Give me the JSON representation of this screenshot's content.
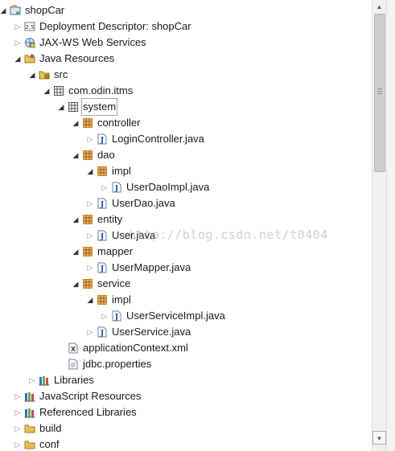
{
  "tree": [
    {
      "label": "shopCar",
      "depth": 0,
      "twisty": "open",
      "icon": "project-icon"
    },
    {
      "label": "Deployment Descriptor: shopCar",
      "depth": 1,
      "twisty": "closed",
      "icon": "descriptor-icon"
    },
    {
      "label": "JAX-WS Web Services",
      "depth": 1,
      "twisty": "closed",
      "icon": "webservice-icon"
    },
    {
      "label": "Java Resources",
      "depth": 1,
      "twisty": "open",
      "icon": "java-resources-icon"
    },
    {
      "label": "src",
      "depth": 2,
      "twisty": "open",
      "icon": "source-folder-icon"
    },
    {
      "label": "com.odin.itms",
      "depth": 3,
      "twisty": "open",
      "icon": "package-empty-icon"
    },
    {
      "label": "system",
      "depth": 4,
      "twisty": "open",
      "icon": "package-empty-icon",
      "selected": true
    },
    {
      "label": "controller",
      "depth": 5,
      "twisty": "open",
      "icon": "package-icon"
    },
    {
      "label": "LoginController.java",
      "depth": 6,
      "twisty": "closed",
      "icon": "java-file-icon"
    },
    {
      "label": "dao",
      "depth": 5,
      "twisty": "open",
      "icon": "package-icon"
    },
    {
      "label": "impl",
      "depth": 6,
      "twisty": "open",
      "icon": "package-icon"
    },
    {
      "label": "UserDaoImpl.java",
      "depth": 7,
      "twisty": "closed",
      "icon": "java-file-icon"
    },
    {
      "label": "UserDao.java",
      "depth": 6,
      "twisty": "closed",
      "icon": "java-file-icon"
    },
    {
      "label": "entity",
      "depth": 5,
      "twisty": "open",
      "icon": "package-icon"
    },
    {
      "label": "User.java",
      "depth": 6,
      "twisty": "closed",
      "icon": "java-file-icon"
    },
    {
      "label": "mapper",
      "depth": 5,
      "twisty": "open",
      "icon": "package-icon"
    },
    {
      "label": "UserMapper.java",
      "depth": 6,
      "twisty": "closed",
      "icon": "java-file-icon"
    },
    {
      "label": "service",
      "depth": 5,
      "twisty": "open",
      "icon": "package-icon"
    },
    {
      "label": "impl",
      "depth": 6,
      "twisty": "open",
      "icon": "package-icon"
    },
    {
      "label": "UserServiceImpl.java",
      "depth": 7,
      "twisty": "closed",
      "icon": "java-file-icon"
    },
    {
      "label": "UserService.java",
      "depth": 6,
      "twisty": "closed",
      "icon": "java-file-icon"
    },
    {
      "label": "applicationContext.xml",
      "depth": 4,
      "twisty": "none",
      "icon": "xml-file-icon"
    },
    {
      "label": "jdbc.properties",
      "depth": 4,
      "twisty": "none",
      "icon": "text-file-icon"
    },
    {
      "label": "Libraries",
      "depth": 2,
      "twisty": "closed",
      "icon": "library-icon"
    },
    {
      "label": "JavaScript Resources",
      "depth": 1,
      "twisty": "closed",
      "icon": "library-icon"
    },
    {
      "label": "Referenced Libraries",
      "depth": 1,
      "twisty": "closed",
      "icon": "library-icon"
    },
    {
      "label": "build",
      "depth": 1,
      "twisty": "closed",
      "icon": "folder-icon"
    },
    {
      "label": "conf",
      "depth": 1,
      "twisty": "closed",
      "icon": "folder-icon"
    }
  ],
  "twisty_glyphs": {
    "open": "◢",
    "closed": "▷",
    "none": ""
  },
  "watermark": "http://blog.csdn.net/t0404",
  "scrollbar": {
    "up_glyph": "▲",
    "down_glyph": "▼"
  },
  "colors": {
    "package": "#c98a2b",
    "java": "#1f4fa8",
    "folder": "#e8c15a",
    "project": "#3b6fc4",
    "selection_outline": "#555555"
  }
}
